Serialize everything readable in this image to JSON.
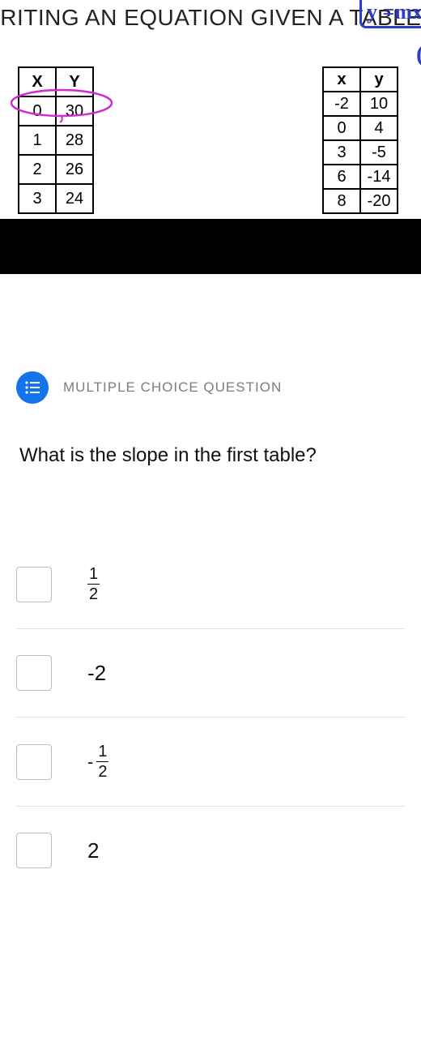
{
  "title": "/RITING AN EQUATION GIVEN A TABLE - YOU DO",
  "handwriting": "y =mx",
  "table1": {
    "headers": [
      "X",
      "Y"
    ],
    "rows": [
      [
        "0",
        "30"
      ],
      [
        "1",
        "28"
      ],
      [
        "2",
        "26"
      ],
      [
        "3",
        "24"
      ]
    ]
  },
  "table2": {
    "headers": [
      "x",
      "y"
    ],
    "rows": [
      [
        "-2",
        "10"
      ],
      [
        "0",
        "4"
      ],
      [
        "3",
        "-5"
      ],
      [
        "6",
        "-14"
      ],
      [
        "8",
        "-20"
      ]
    ]
  },
  "mc_label": "MULTIPLE CHOICE QUESTION",
  "question": "What is the slope in the first table?",
  "choices": {
    "a": {
      "type": "fraction",
      "neg": false,
      "num": "1",
      "den": "2"
    },
    "b": {
      "type": "plain",
      "text": "-2"
    },
    "c": {
      "type": "fraction",
      "neg": true,
      "num": "1",
      "den": "2"
    },
    "d": {
      "type": "plain",
      "text": "2"
    }
  },
  "chart_data": [
    {
      "type": "table",
      "headers": [
        "X",
        "Y"
      ],
      "rows": [
        [
          0,
          30
        ],
        [
          1,
          28
        ],
        [
          2,
          26
        ],
        [
          3,
          24
        ]
      ]
    },
    {
      "type": "table",
      "headers": [
        "x",
        "y"
      ],
      "rows": [
        [
          -2,
          10
        ],
        [
          0,
          4
        ],
        [
          3,
          -5
        ],
        [
          6,
          -14
        ],
        [
          8,
          -20
        ]
      ]
    }
  ]
}
